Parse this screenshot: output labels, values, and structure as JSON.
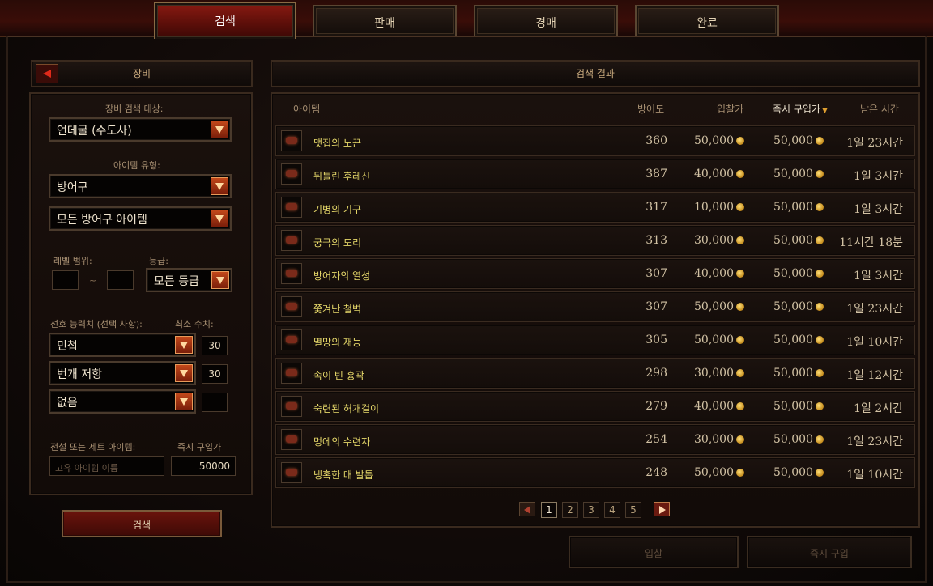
{
  "tabs": [
    {
      "label": "검색",
      "active": true
    },
    {
      "label": "판매",
      "active": false
    },
    {
      "label": "경매",
      "active": false
    },
    {
      "label": "완료",
      "active": false
    }
  ],
  "left_panel": {
    "header": "장비",
    "search_target_label": "장비 검색 대상:",
    "search_target_value": "언데굴 (수도사)",
    "item_type_label": "아이템 유형:",
    "item_type_value": "방어구",
    "item_subtype_value": "모든 방어구 아이템",
    "level_range_label": "레벨 범위:",
    "level_tilde": "~",
    "level_min": "",
    "level_max": "",
    "grade_label": "등급:",
    "grade_value": "모든 등급",
    "preferred_stats_label": "선호 능력치 (선택 사항):",
    "min_value_label": "최소 수치:",
    "stats": [
      {
        "name": "민첩",
        "min": "30"
      },
      {
        "name": "번개 저항",
        "min": "30"
      },
      {
        "name": "없음",
        "min": ""
      }
    ],
    "legendary_label": "전설 또는 세트 아이템:",
    "buyout_label": "즉시 구입가",
    "unique_name_placeholder": "고유 아이템 이름",
    "buyout_value": "50000",
    "search_button": "검색"
  },
  "results": {
    "header": "검색 결과",
    "columns": {
      "item": "아이템",
      "armor": "방어도",
      "bid": "입찰가",
      "buyout": "즉시 구입가",
      "time_left": "남은 시간"
    },
    "rows": [
      {
        "name": "맷집의 노끈",
        "armor": "360",
        "bid": "50,000",
        "buyout": "50,000",
        "time": "1일 23시간"
      },
      {
        "name": "뒤틀린 후레신",
        "armor": "387",
        "bid": "40,000",
        "buyout": "50,000",
        "time": "1일 3시간"
      },
      {
        "name": "기병의 기구",
        "armor": "317",
        "bid": "10,000",
        "buyout": "50,000",
        "time": "1일 3시간"
      },
      {
        "name": "궁극의 도리",
        "armor": "313",
        "bid": "30,000",
        "buyout": "50,000",
        "time": "11시간 18분"
      },
      {
        "name": "방어자의 열성",
        "armor": "307",
        "bid": "40,000",
        "buyout": "50,000",
        "time": "1일 3시간"
      },
      {
        "name": "쫓겨난 철벽",
        "armor": "307",
        "bid": "50,000",
        "buyout": "50,000",
        "time": "1일 23시간"
      },
      {
        "name": "멸망의 재능",
        "armor": "305",
        "bid": "50,000",
        "buyout": "50,000",
        "time": "1일 10시간"
      },
      {
        "name": "속이 빈 흉곽",
        "armor": "298",
        "bid": "30,000",
        "buyout": "50,000",
        "time": "1일 12시간"
      },
      {
        "name": "숙련된 허개걸이",
        "armor": "279",
        "bid": "40,000",
        "buyout": "50,000",
        "time": "1일 2시간"
      },
      {
        "name": "멍에의 수련자",
        "armor": "254",
        "bid": "30,000",
        "buyout": "50,000",
        "time": "1일 23시간"
      },
      {
        "name": "냉혹한 매 발톱",
        "armor": "248",
        "bid": "50,000",
        "buyout": "50,000",
        "time": "1일 10시간"
      }
    ],
    "pages": [
      "1",
      "2",
      "3",
      "4",
      "5"
    ],
    "current_page": "1"
  },
  "actions": {
    "bid_button": "입찰",
    "buyout_button": "즉시 구입"
  }
}
